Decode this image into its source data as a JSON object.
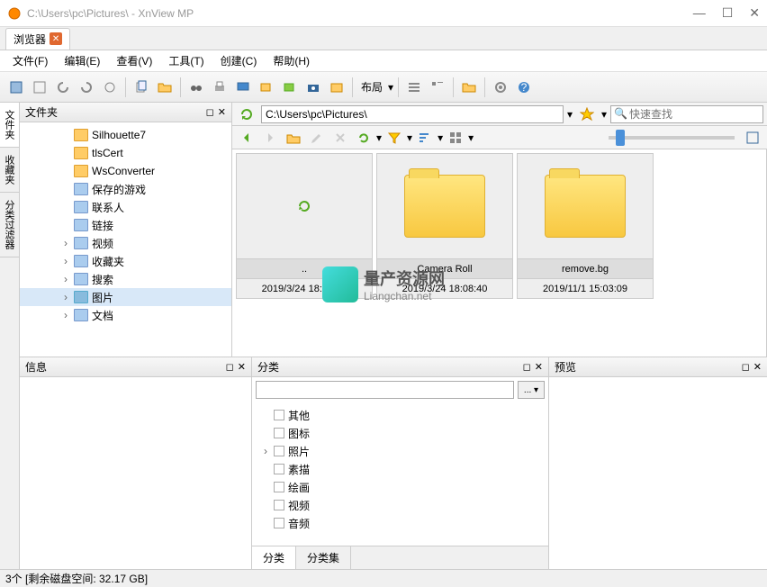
{
  "window": {
    "title": "C:\\Users\\pc\\Pictures\\ - XnView MP"
  },
  "tab": {
    "label": "浏览器"
  },
  "menu": {
    "file": "文件(F)",
    "edit": "编辑(E)",
    "view": "查看(V)",
    "tools": "工具(T)",
    "create": "创建(C)",
    "help": "帮助(H)"
  },
  "toolbar": {
    "layout": "布局"
  },
  "side_tabs": {
    "folder": "文件夹",
    "fav": "收藏夹",
    "filter": "分类过滤器"
  },
  "panels": {
    "folders": "文件夹",
    "info": "信息",
    "category": "分类",
    "preview": "预览"
  },
  "tree": [
    {
      "label": "Silhouette7",
      "icon": "folder"
    },
    {
      "label": "tlsCert",
      "icon": "folder"
    },
    {
      "label": "WsConverter",
      "icon": "folder"
    },
    {
      "label": "保存的游戏",
      "icon": "sys"
    },
    {
      "label": "联系人",
      "icon": "sys"
    },
    {
      "label": "链接",
      "icon": "sys"
    },
    {
      "label": "视频",
      "icon": "sys",
      "exp": true
    },
    {
      "label": "收藏夹",
      "icon": "sys",
      "exp": true
    },
    {
      "label": "搜索",
      "icon": "sys",
      "exp": true
    },
    {
      "label": "图片",
      "icon": "blue",
      "exp": true,
      "sel": true
    },
    {
      "label": "文档",
      "icon": "sys",
      "exp": true
    }
  ],
  "address": {
    "path": "C:\\Users\\pc\\Pictures\\",
    "search_placeholder": "快速查找"
  },
  "thumbs": [
    {
      "name": "..",
      "date": "2019/3/24 18:08:19",
      "up": true
    },
    {
      "name": "Camera Roll",
      "date": "2019/3/24 18:08:40"
    },
    {
      "name": "remove.bg",
      "date": "2019/11/1 15:03:09"
    }
  ],
  "watermark": {
    "text1": "量产资源网",
    "text2": "Liangchan.net"
  },
  "category": {
    "btn": "... ▾",
    "items": [
      "其他",
      "图标",
      "照片",
      "素描",
      "绘画",
      "视频",
      "音频"
    ],
    "tab1": "分类",
    "tab2": "分类集"
  },
  "status": "3个 [剩余磁盘空间: 32.17 GB]"
}
